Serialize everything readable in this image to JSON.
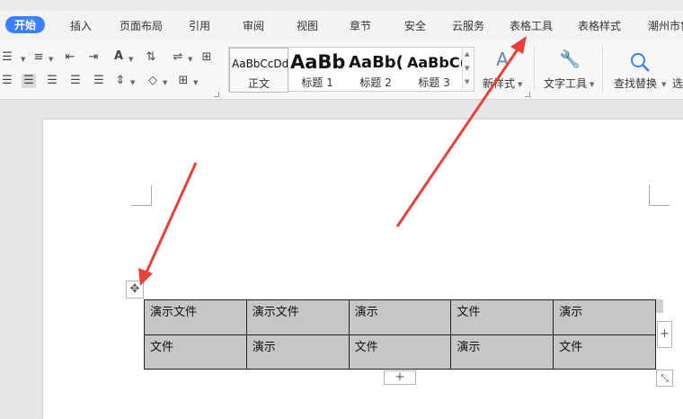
{
  "tabs": [
    {
      "label": "开始",
      "active": true
    },
    {
      "label": "插入"
    },
    {
      "label": "页面布局"
    },
    {
      "label": "引用"
    },
    {
      "label": "审阅"
    },
    {
      "label": "视图"
    },
    {
      "label": "章节"
    },
    {
      "label": "安全"
    },
    {
      "label": "云服务"
    },
    {
      "label": "表格工具"
    },
    {
      "label": "表格样式"
    },
    {
      "label": "潮州市鲁"
    }
  ],
  "styles": {
    "items": [
      {
        "sample": "AaBbCcDd",
        "name": "正文"
      },
      {
        "sample": "AaBb",
        "name": "标题 1"
      },
      {
        "sample": "AaBb(",
        "name": "标题 2"
      },
      {
        "sample": "AaBbC(",
        "name": "标题 3"
      }
    ]
  },
  "toolbar": {
    "new_style_label": "新样式",
    "text_tools_label": "文字工具",
    "find_replace_label": "查找替换",
    "select_label": "选"
  },
  "table": {
    "rows": [
      [
        "演示文件",
        "演示文件",
        "演示",
        "文件",
        "演示"
      ],
      [
        "文件",
        "演示",
        "文件",
        "演示",
        "文件"
      ]
    ]
  },
  "colors": {
    "accent": "#3f7ff4",
    "annotation_arrow": "#e8403a",
    "table_fill": "#c6c6c6"
  }
}
